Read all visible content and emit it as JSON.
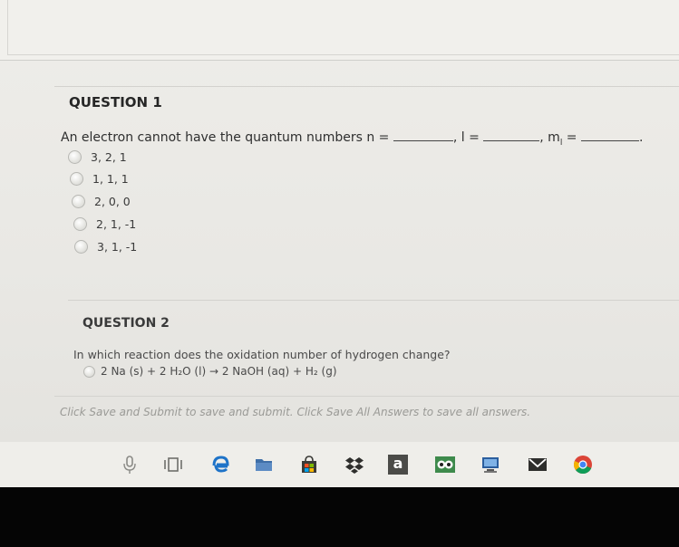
{
  "question1": {
    "heading": "QUESTION 1",
    "prompt_start": "An electron cannot have the quantum numbers n = ",
    "l_label": ", l = ",
    "ml_label": ", m",
    "ml_sub": "l",
    "ml_eq": " = ",
    "prompt_end": ".",
    "options": [
      "3, 2, 1",
      "1, 1, 1",
      "2, 0, 0",
      "2, 1, -1",
      "3, 1, -1"
    ]
  },
  "question2": {
    "heading": "QUESTION 2",
    "prompt": "In which reaction does the oxidation number of hydrogen change?",
    "options": [
      "2 Na (s) + 2 H₂O (l) → 2 NaOH (aq) + H₂ (g)"
    ]
  },
  "footer": {
    "note": "Click Save and Submit to save and submit. Click Save All Answers to save all answers."
  },
  "taskbar": {
    "icons": [
      "microphone-icon",
      "task-view-icon",
      "edge-icon",
      "file-explorer-icon",
      "store-icon",
      "dropbox-icon",
      "amazon-icon",
      "tripadvisor-icon",
      "computer-icon",
      "mail-icon",
      "chrome-icon"
    ],
    "amazon_letter": "a"
  }
}
